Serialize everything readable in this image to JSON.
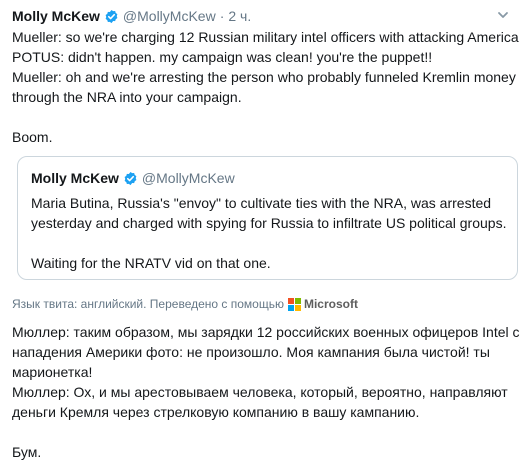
{
  "tweet": {
    "name": "Molly McKew",
    "handle": "@MollyMcKew",
    "separator": "·",
    "time": "2 ч.",
    "lines": [
      "Mueller: so we're charging 12 Russian military intel officers with attacking America",
      "POTUS: didn't happen. my campaign was clean! you're the puppet!!",
      "Mueller: oh and we're arresting the person who probably funneled Kremlin money",
      "through the NRA into your campaign.",
      "",
      "Boom."
    ]
  },
  "quote": {
    "name": "Molly McKew",
    "handle": "@MollyMcKew",
    "lines": [
      "Maria Butina, Russia's \"envoy\" to cultivate ties with the NRA, was arrested",
      "yesterday and charged with spying for Russia to infiltrate US political groups.",
      "",
      "Waiting for the NRATV vid on that one."
    ]
  },
  "translation": {
    "meta_label": "Язык твита: английский. Переведено с помощью",
    "provider": "Microsoft",
    "lines": [
      "Мюллер: таким образом, мы зарядки 12 российских военных офицеров Intel с",
      "нападения Америки фото: не произошло. Моя кампания была чистой! ты",
      "марионетка!",
      "Мюллер: Ох, и мы арестовываем человека, который, вероятно, направляют",
      "деньги Кремля через стрелковую компанию в вашу кампанию.",
      "",
      "Бум."
    ]
  },
  "icons": {
    "verified": "verified-badge-icon",
    "caret": "chevron-down-icon",
    "provider_logo": "microsoft-logo-icon"
  },
  "colors": {
    "verified_blue": "#1da1f2",
    "secondary_text": "#657786",
    "border": "#ccd6dd",
    "ms_red": "#f25022",
    "ms_green": "#7fba00",
    "ms_blue": "#00a4ef",
    "ms_yellow": "#ffb900"
  }
}
